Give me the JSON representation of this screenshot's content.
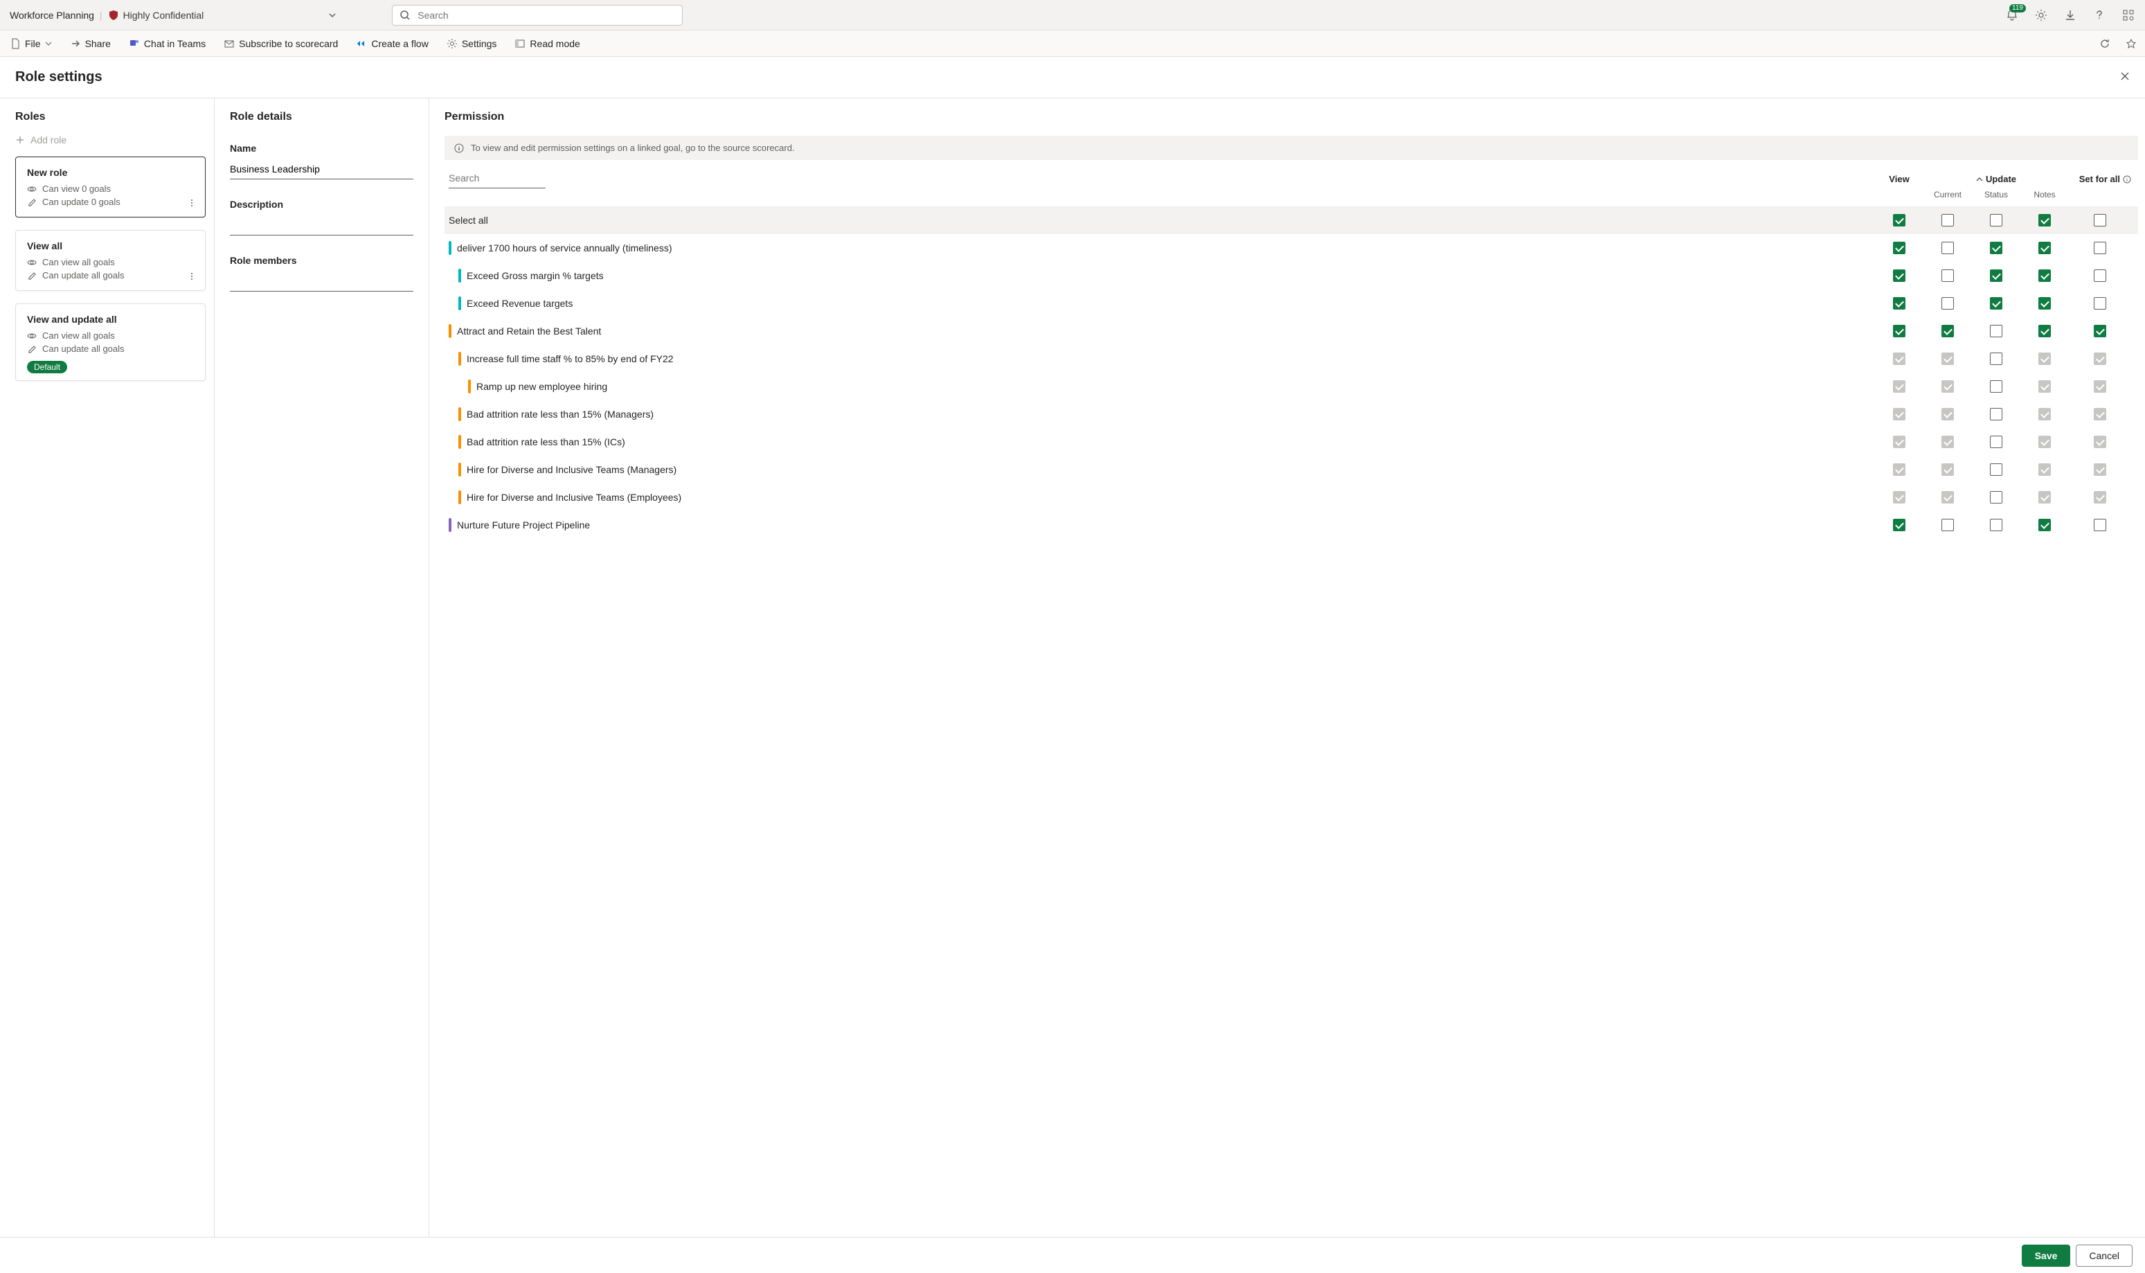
{
  "header": {
    "app_title": "Workforce Planning",
    "confidentiality": "Highly Confidential",
    "search_placeholder": "Search",
    "notification_count": "119"
  },
  "ribbon": {
    "file": "File",
    "share": "Share",
    "chat": "Chat in Teams",
    "subscribe": "Subscribe to scorecard",
    "flow": "Create a flow",
    "settings": "Settings",
    "read": "Read mode"
  },
  "page": {
    "title": "Role settings"
  },
  "roles_panel": {
    "title": "Roles",
    "add_role": "Add role",
    "cards": [
      {
        "name": "New role",
        "view_text": "Can view 0 goals",
        "update_text": "Can update 0 goals",
        "selected": true,
        "default": false,
        "has_more": true
      },
      {
        "name": "View all",
        "view_text": "Can view all goals",
        "update_text": "Can update all goals",
        "selected": false,
        "default": false,
        "has_more": true
      },
      {
        "name": "View and update all",
        "view_text": "Can view all goals",
        "update_text": "Can update all goals",
        "selected": false,
        "default": true,
        "has_more": false
      }
    ],
    "default_label": "Default"
  },
  "details_panel": {
    "title": "Role details",
    "name_label": "Name",
    "name_value": "Business Leadership",
    "desc_label": "Description",
    "desc_value": "",
    "members_label": "Role members",
    "members_value": ""
  },
  "permission_panel": {
    "title": "Permission",
    "info": "To view and edit permission settings on a linked goal, go to the source scorecard.",
    "search_placeholder": "Search",
    "columns": {
      "view": "View",
      "update": "Update",
      "current": "Current",
      "status": "Status",
      "notes": "Notes",
      "set_for_all": "Set for all"
    },
    "select_all_label": "Select all",
    "select_all": {
      "view": "checked",
      "current": "unchecked",
      "status": "unchecked",
      "notes": "checked",
      "set_for_all": "unchecked"
    },
    "rows": [
      {
        "label": "deliver 1700 hours of service annually (timeliness)",
        "color": "teal",
        "indent": 0,
        "disabled": false,
        "view": "checked",
        "current": "unchecked",
        "status": "checked",
        "notes": "checked",
        "set_for_all": "unchecked"
      },
      {
        "label": "Exceed Gross margin % targets",
        "color": "teal",
        "indent": 1,
        "disabled": false,
        "view": "checked",
        "current": "unchecked",
        "status": "checked",
        "notes": "checked",
        "set_for_all": "unchecked"
      },
      {
        "label": "Exceed Revenue targets",
        "color": "teal",
        "indent": 1,
        "disabled": false,
        "view": "checked",
        "current": "unchecked",
        "status": "checked",
        "notes": "checked",
        "set_for_all": "unchecked"
      },
      {
        "label": "Attract and Retain the Best Talent",
        "color": "orange",
        "indent": 0,
        "disabled": false,
        "view": "checked",
        "current": "checked",
        "status": "unchecked",
        "notes": "checked",
        "set_for_all": "checked"
      },
      {
        "label": "Increase full time staff % to 85% by end of FY22",
        "color": "orange",
        "indent": 1,
        "disabled": true,
        "view": "checked",
        "current": "checked",
        "status": "unchecked",
        "notes": "checked",
        "set_for_all": "checked"
      },
      {
        "label": "Ramp up new employee hiring",
        "color": "orange",
        "indent": 2,
        "disabled": true,
        "view": "checked",
        "current": "checked",
        "status": "unchecked",
        "notes": "checked",
        "set_for_all": "checked"
      },
      {
        "label": "Bad attrition rate less than 15% (Managers)",
        "color": "orange",
        "indent": 1,
        "disabled": true,
        "view": "checked",
        "current": "checked",
        "status": "unchecked",
        "notes": "checked",
        "set_for_all": "checked"
      },
      {
        "label": "Bad attrition rate less than 15% (ICs)",
        "color": "orange",
        "indent": 1,
        "disabled": true,
        "view": "checked",
        "current": "checked",
        "status": "unchecked",
        "notes": "checked",
        "set_for_all": "checked"
      },
      {
        "label": "Hire for Diverse and Inclusive Teams (Managers)",
        "color": "orange",
        "indent": 1,
        "disabled": true,
        "view": "checked",
        "current": "checked",
        "status": "unchecked",
        "notes": "checked",
        "set_for_all": "checked"
      },
      {
        "label": "Hire for Diverse and Inclusive Teams (Employees)",
        "color": "orange",
        "indent": 1,
        "disabled": true,
        "view": "checked",
        "current": "checked",
        "status": "unchecked",
        "notes": "checked",
        "set_for_all": "checked"
      },
      {
        "label": "Nurture Future Project Pipeline",
        "color": "purple",
        "indent": 0,
        "disabled": false,
        "view": "checked",
        "current": "unchecked",
        "status": "unchecked",
        "notes": "checked",
        "set_for_all": "unchecked"
      }
    ]
  },
  "footer": {
    "save": "Save",
    "cancel": "Cancel"
  }
}
